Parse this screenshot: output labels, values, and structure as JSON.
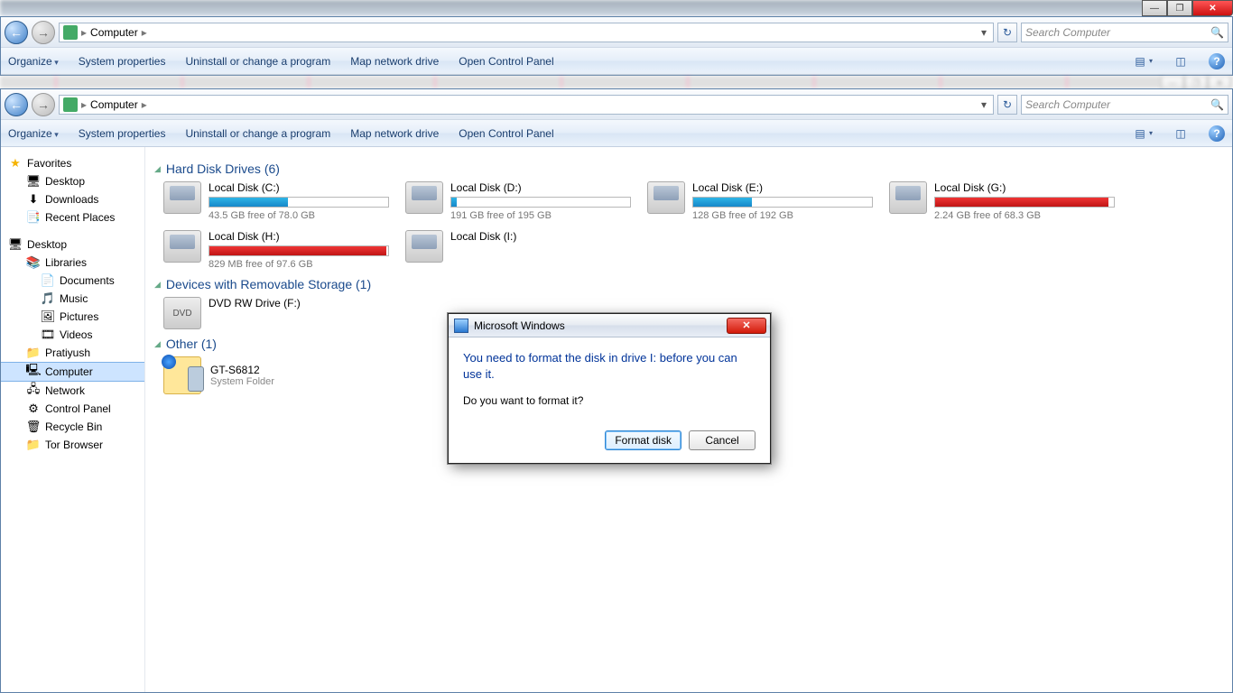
{
  "win_outer": {
    "breadcrumb_root_icon": "computer-icon",
    "breadcrumb_label": "Computer",
    "search_placeholder": "Search Computer",
    "toolbar": {
      "organize": "Organize",
      "sysprops": "System properties",
      "uninstall": "Uninstall or change a program",
      "mapdrive": "Map network drive",
      "opencp": "Open Control Panel"
    }
  },
  "win_inner": {
    "breadcrumb_label": "Computer",
    "search_placeholder": "Search Computer",
    "toolbar": {
      "organize": "Organize",
      "sysprops": "System properties",
      "uninstall": "Uninstall or change a program",
      "mapdrive": "Map network drive",
      "opencp": "Open Control Panel"
    }
  },
  "sidebar": {
    "favorites_label": "Favorites",
    "fav_items": [
      "Desktop",
      "Downloads",
      "Recent Places"
    ],
    "desktop_label": "Desktop",
    "libraries_label": "Libraries",
    "lib_items": [
      "Documents",
      "Music",
      "Pictures",
      "Videos"
    ],
    "user_folder": "Pratiyush",
    "computer_label": "Computer",
    "network_label": "Network",
    "control_panel_label": "Control Panel",
    "recycle_label": "Recycle Bin",
    "tor_label": "Tor Browser"
  },
  "sections": {
    "hdd_label": "Hard Disk Drives (6)",
    "removable_label": "Devices with Removable Storage (1)",
    "other_label": "Other (1)"
  },
  "drives": [
    {
      "name": "Local Disk (C:)",
      "free": "43.5 GB free of 78.0 GB",
      "fill_pct": 44,
      "red": false
    },
    {
      "name": "Local Disk (D:)",
      "free": "191 GB free of 195 GB",
      "fill_pct": 3,
      "red": false
    },
    {
      "name": "Local Disk (E:)",
      "free": "128 GB free of 192 GB",
      "fill_pct": 33,
      "red": false
    },
    {
      "name": "Local Disk (G:)",
      "free": "2.24 GB free of 68.3 GB",
      "fill_pct": 97,
      "red": true
    },
    {
      "name": "Local Disk (H:)",
      "free": "829 MB free of 97.6 GB",
      "fill_pct": 99,
      "red": true
    },
    {
      "name": "Local Disk (I:)",
      "free": "",
      "fill_pct": 0,
      "red": false,
      "nobar": true
    }
  ],
  "removable": {
    "name": "DVD RW Drive (F:)"
  },
  "other": {
    "name": "GT-S6812",
    "sub": "System Folder"
  },
  "dialog": {
    "title": "Microsoft Windows",
    "message": "You need to format the disk in drive I: before you can use it.",
    "question": "Do you want to format it?",
    "format_btn": "Format disk",
    "cancel_btn": "Cancel"
  }
}
